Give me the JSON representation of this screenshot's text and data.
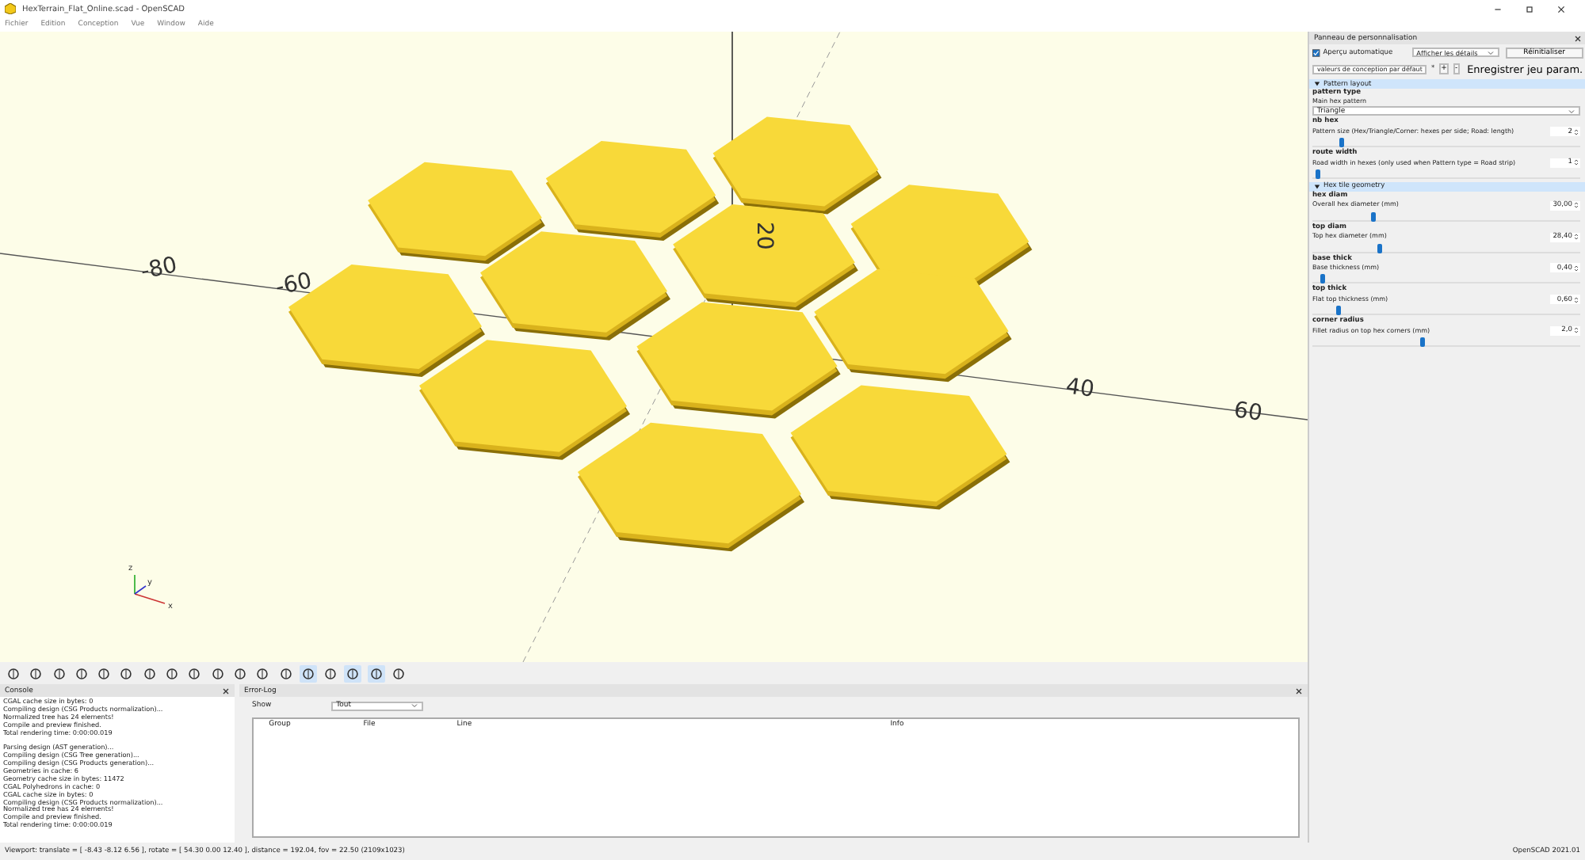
{
  "window": {
    "title": "HexTerrain_Flat_Online.scad - OpenSCAD"
  },
  "menu": [
    "Fichier",
    "Edition",
    "Conception",
    "Vue",
    "Window",
    "Aide"
  ],
  "viewport": {
    "axis_labels": [
      "-80",
      "-60",
      "40",
      "60",
      "20"
    ],
    "gizmo_labels": [
      "z",
      "y",
      "x"
    ]
  },
  "toolbar": [
    {
      "selected": false
    },
    {
      "selected": false
    },
    {
      "selected": false
    },
    {
      "selected": false
    },
    {
      "selected": false
    },
    {
      "selected": false
    },
    {
      "selected": false
    },
    {
      "selected": false
    },
    {
      "selected": false
    },
    {
      "selected": false
    },
    {
      "selected": false
    },
    {
      "selected": false
    },
    {
      "selected": false
    },
    {
      "selected": true
    },
    {
      "selected": false
    },
    {
      "selected": true
    },
    {
      "selected": true
    },
    {
      "selected": false
    }
  ],
  "console": {
    "title": "Console",
    "blocks": [
      [
        "CGAL cache size in bytes: 0",
        "Compiling design (CSG Products normalization)...",
        "Normalized tree has 24 elements!",
        "Compile and preview finished.",
        "Total rendering time: 0:00:00.019"
      ],
      [
        "Parsing design (AST generation)...",
        "Compiling design (CSG Tree generation)...",
        "Compiling design (CSG Products generation)...",
        "Geometries in cache: 6",
        "Geometry cache size in bytes: 11472",
        "CGAL Polyhedrons in cache: 0",
        "CGAL cache size in bytes: 0",
        "Compiling design (CSG Products normalization)...",
        "Normalized tree has 24 elements!",
        "Compile and preview finished.",
        "Total rendering time: 0:00:00.019"
      ]
    ]
  },
  "error_log": {
    "title": "Error-Log",
    "show_label": "Show",
    "show_value": "Tout",
    "columns": [
      "Group",
      "File",
      "Line",
      "Info"
    ]
  },
  "customizer": {
    "title": "Panneau de personnalisation",
    "auto_preview": {
      "label": "Aperçu automatique",
      "checked": true
    },
    "details": "Afficher les détails",
    "reset": "Réinitialiser",
    "preset": "valeurs de conception par défaut",
    "preset_mark": "*",
    "add": "+",
    "remove": "-",
    "save": "Enregistrer jeu param.",
    "sections": [
      {
        "title": "Pattern layout",
        "expanded": true,
        "params": [
          {
            "kind": "select",
            "name": "pattern type",
            "description": "Main hex pattern",
            "value": "Triangle"
          },
          {
            "kind": "spin",
            "name": "nb hex",
            "description": "Pattern size (Hex/Triangle/Corner: hexes per side; Road: length)",
            "value": "2",
            "level": 0.1
          },
          {
            "kind": "spin",
            "name": "route width",
            "description": "Road width in hexes (only used when Pattern type = Road strip)",
            "value": "1",
            "level": 0.01
          }
        ]
      },
      {
        "title": "Hex tile geometry",
        "expanded": true,
        "params": [
          {
            "kind": "spin",
            "name": "hex diam",
            "description": "Overall hex diameter (mm)",
            "value": "30,00",
            "level": 0.22
          },
          {
            "kind": "spin",
            "name": "top diam",
            "description": "Top hex diameter (mm)",
            "value": "28,40",
            "level": 0.24
          },
          {
            "kind": "spin",
            "name": "base thick",
            "description": "Base thickness (mm)",
            "value": "0,40",
            "level": 0.03
          },
          {
            "kind": "spin",
            "name": "top thick",
            "description": "Flat top thickness (mm)",
            "value": "0,60",
            "level": 0.09
          },
          {
            "kind": "spin",
            "name": "corner radius",
            "description": "Fillet radius on top hex corners (mm)",
            "value": "2,0",
            "level": 0.4
          }
        ]
      }
    ]
  },
  "status_bar": {
    "viewport": "Viewport: translate = [ -8.43 -8.12 6.56 ], rotate = [ 54.30 0.00 12.40 ], distance = 192.04, fov = 22.50 (2109x1023)",
    "version": "OpenSCAD 2021.01"
  }
}
